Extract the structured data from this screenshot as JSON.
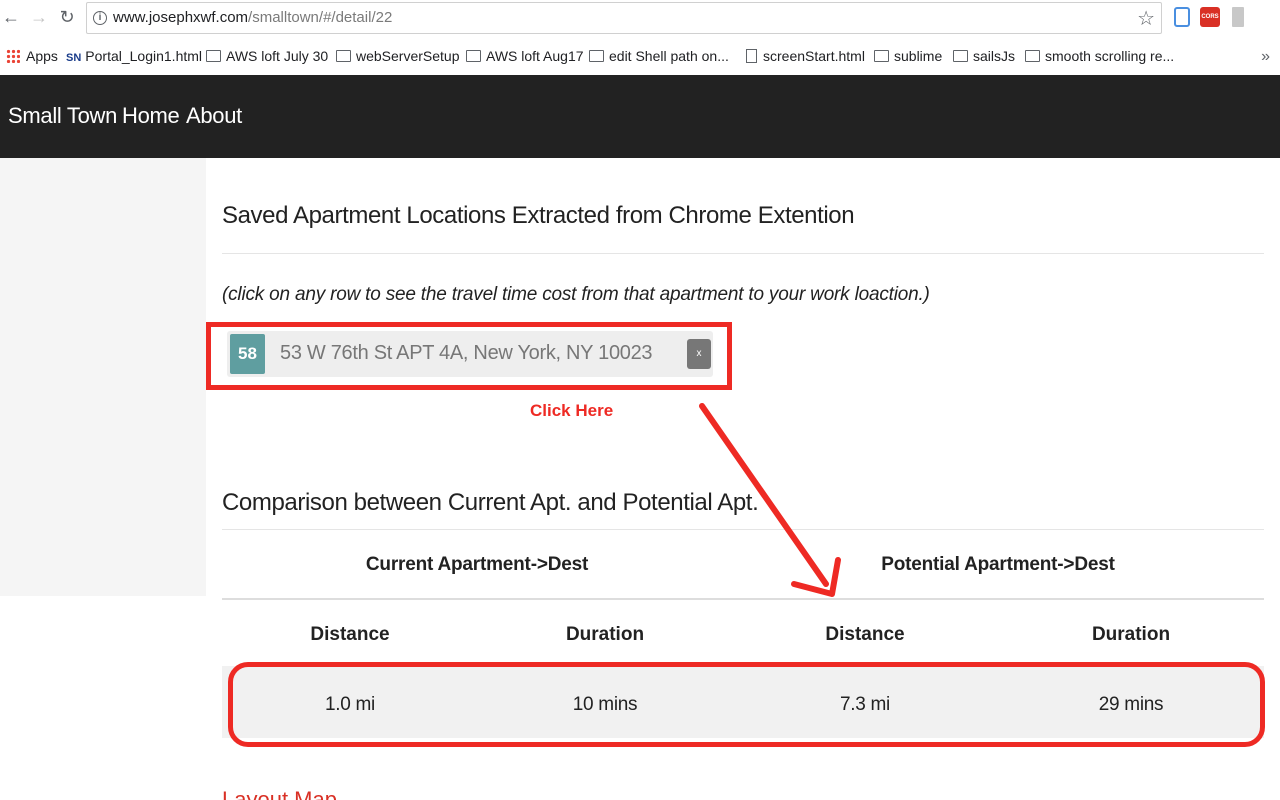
{
  "browser": {
    "url_host": "www.josephxwf.com",
    "url_path": "/smalltown/#/detail/22",
    "extensions": {
      "cors_label": "CORS"
    },
    "bookmarks": [
      "Apps",
      "Portal_Login1.html",
      "AWS loft July 30",
      "webServerSetup",
      "AWS loft Aug17",
      "edit Shell path on...",
      "screenStart.html",
      "sublime",
      "sailsJs",
      "smooth scrolling re..."
    ],
    "bookmarks_more": "»"
  },
  "navbar": {
    "brand": "Small Town",
    "links": [
      "Home",
      "About"
    ]
  },
  "saved": {
    "heading": "Saved Apartment Locations Extracted from Chrome Extention",
    "hint": "(click on any row to see the travel time cost from that apartment to your work loaction.)",
    "item": {
      "badge": "58",
      "address": "53 W 76th St APT 4A, New York, NY 10023",
      "remove_label": "x"
    }
  },
  "annotation": {
    "click_here": "Click Here",
    "color": "#ee2a24"
  },
  "comparison": {
    "heading": "Comparison between Current Apt. and Potential Apt.",
    "groups": [
      "Current Apartment->Dest",
      "Potential Apartment->Dest"
    ],
    "columns": [
      "Distance",
      "Duration",
      "Distance",
      "Duration"
    ],
    "row": [
      "1.0 mi",
      "10 mins",
      "7.3 mi",
      "29 mins"
    ]
  },
  "below": {
    "cut_text": "Layout Map"
  },
  "colors": {
    "navbar_bg": "#222222",
    "badge_bg": "#5f9ea0",
    "accent_red": "#ee2a24"
  }
}
